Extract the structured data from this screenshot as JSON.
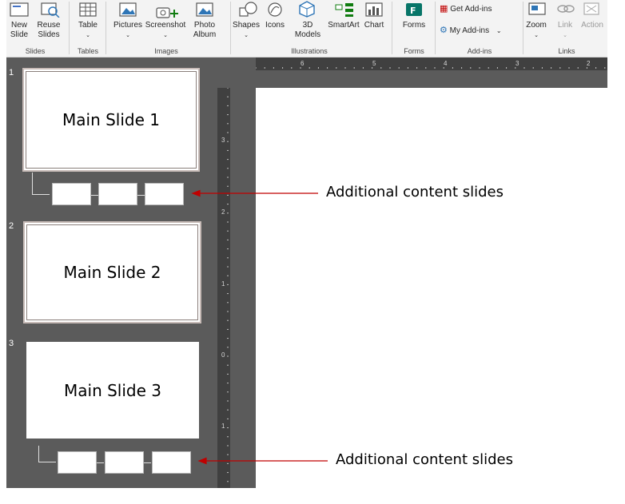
{
  "ribbon": {
    "buttons": {
      "new_slide": "New Slide",
      "reuse_slides": "Reuse Slides",
      "table": "Table",
      "pictures": "Pictures",
      "screenshot": "Screenshot",
      "photo_album": "Photo Album",
      "shapes": "Shapes",
      "icons": "Icons",
      "3d_models": "3D Models",
      "smartart": "SmartArt",
      "chart": "Chart",
      "forms": "Forms",
      "get_addins": "Get Add-ins",
      "my_addins": "My Add-ins",
      "zoom": "Zoom",
      "link": "Link",
      "action": "Action"
    },
    "groups": {
      "slides": "Slides",
      "tables": "Tables",
      "images": "Images",
      "illustrations": "Illustrations",
      "forms": "Forms",
      "addins": "Add-ins",
      "links": "Links"
    }
  },
  "rulers": {
    "horizontal": [
      "6",
      "5",
      "4",
      "3",
      "2"
    ],
    "vertical": [
      "3",
      "2",
      "1",
      "0",
      "1"
    ]
  },
  "slides": [
    {
      "number": "1",
      "title": "Main Slide 1"
    },
    {
      "number": "2",
      "title": "Main Slide 2"
    },
    {
      "number": "3",
      "title": "Main Slide 3"
    }
  ],
  "annotations": [
    "Additional content slides",
    "Additional content slides"
  ],
  "colors": {
    "accent_arrow": "#c00000",
    "workspace": "#5b5b5b",
    "ribbon": "#f3f3f3"
  }
}
